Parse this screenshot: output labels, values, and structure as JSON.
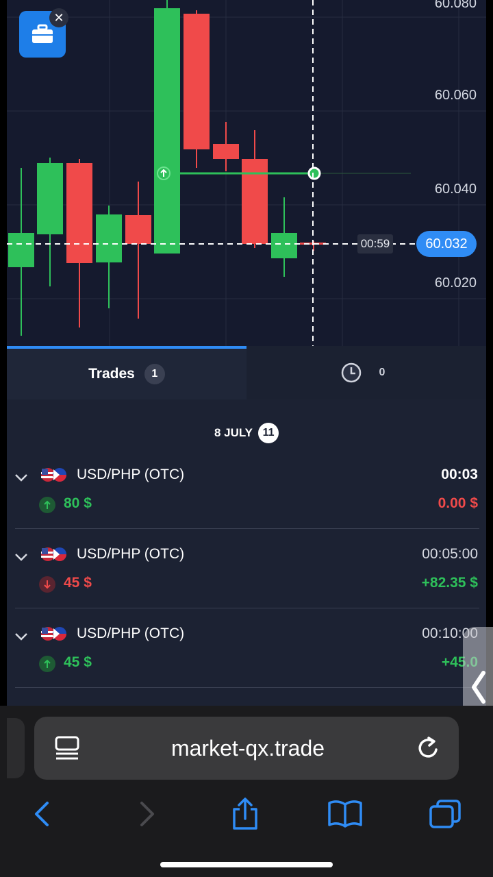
{
  "chart": {
    "prices": {
      "p080": "60.080",
      "p060": "60.060",
      "p040": "60.040",
      "p020": "60.020",
      "current": "60.032"
    },
    "timer": "00:59"
  },
  "tabs": {
    "trades_label": "Trades",
    "trades_count": "1",
    "pending_count": "0"
  },
  "date": {
    "label": "8 JULY",
    "count": "11"
  },
  "trades": [
    {
      "pair": "USD/PHP (OTC)",
      "time": "00:03",
      "amount": "80 $",
      "pnl": "0.00 $",
      "direction": "up"
    },
    {
      "pair": "USD/PHP (OTC)",
      "time": "00:05:00",
      "amount": "45 $",
      "pnl": "+82.35 $",
      "direction": "down"
    },
    {
      "pair": "USD/PHP (OTC)",
      "time": "00:10:00",
      "amount": "45 $",
      "pnl": "+45.0",
      "direction": "up"
    }
  ],
  "browser": {
    "url": "market-qx.trade"
  },
  "colors": {
    "bull": "#2ec05a",
    "bear": "#f04a4a",
    "accent": "#2f8cf5",
    "panel": "#1c2233",
    "chart_bg": "#151a2e"
  }
}
